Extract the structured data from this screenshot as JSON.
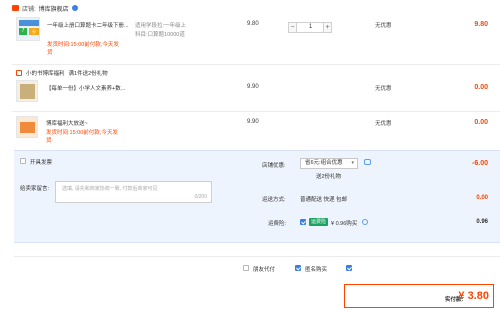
{
  "shop": {
    "label": "店铺:",
    "name": "博库旗舰店"
  },
  "items": [
    {
      "title_line1": "一年级上册口算题卡二年级下册...",
      "title_line2": "",
      "spec_line1": "适用学段拉:一年级上",
      "spec_line2": "科目:口算题10000道",
      "ship_line1": "发货时间:15:00前付款,今天发",
      "ship_line2": "货",
      "price": "9.80",
      "qty": "1",
      "discount": "无优惠",
      "subtotal": "9.80"
    },
    {
      "title_line1": "【每单一份】小学人文素养+数...",
      "price": "9.90",
      "discount": "无优惠",
      "subtotal": "0.00"
    },
    {
      "title_line1": "博库福利大放送~",
      "ship_line1": "发货时间:15:00前付款,今天发",
      "ship_line2": "货",
      "price": "9.90",
      "discount": "无优惠",
      "subtotal": "0.00"
    }
  ],
  "gift_bar": {
    "shop_name": "小的书博库福利",
    "rule": "满1件送2份礼物"
  },
  "order": {
    "anonymous_label": "开具发票",
    "message_label": "给卖家留言:",
    "message_placeholder": "选填, 请先和商家协商一致, 付款后商家可见",
    "message_counter": "0/200",
    "shop_discount_label": "店铺优惠:",
    "shop_discount_value": "省6元:组合优惠",
    "shop_discount_amount": "-6.00",
    "gift_text": "送2份礼物",
    "shipping_label": "运送方式:",
    "shipping_value": "普通配送 快递 包邮",
    "shipping_amount": "0.00",
    "insurance_label": "运费险:",
    "insurance_tag": "运费险",
    "insurance_text": "¥ 0.96购买",
    "insurance_amount": "0.96"
  },
  "footer": {
    "friend_pay": "朋友代付",
    "anonymous_buy": "匿名购买",
    "total_label": "实付款:",
    "total_value": "¥ 3.80"
  },
  "colors": {
    "price_red": "#ff4400",
    "brand_blue": "#3a7ee8",
    "panel_bg": "#eef4fd"
  }
}
